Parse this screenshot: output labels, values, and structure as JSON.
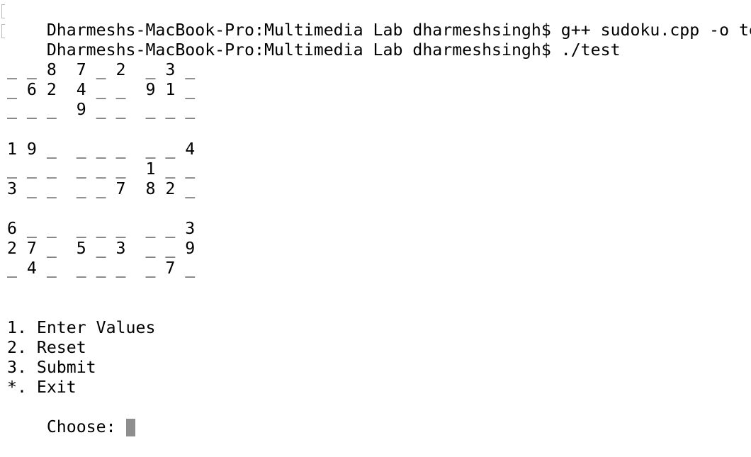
{
  "terminal": {
    "lines": [
      "Dharmeshs-MacBook-Pro:Multimedia Lab dharmeshsingh$ g++ sudoku.cpp -o test",
      "Dharmeshs-MacBook-Pro:Multimedia Lab dharmeshsingh$ ./test",
      "",
      "_ _ 8  7 _ 2  _ 3 _",
      "_ 6 2  4 _ _  9 1 _",
      "_ _ _  9 _ _  _ _ _",
      "",
      "1 9 _  _ _ _  _ _ 4",
      "_ _ _  _ _ _  1 _ _",
      "3 _ _  _ _ 7  8 2 _",
      "",
      "6 _ _  _ _ _  _ _ 3",
      "2 7 _  5 _ 3  _ _ 9",
      "_ 4 _  _ _ _  _ 7 _",
      "",
      "",
      "1. Enter Values",
      "2. Reset",
      "3. Submit",
      "*. Exit"
    ],
    "prompt": "Choose:"
  }
}
